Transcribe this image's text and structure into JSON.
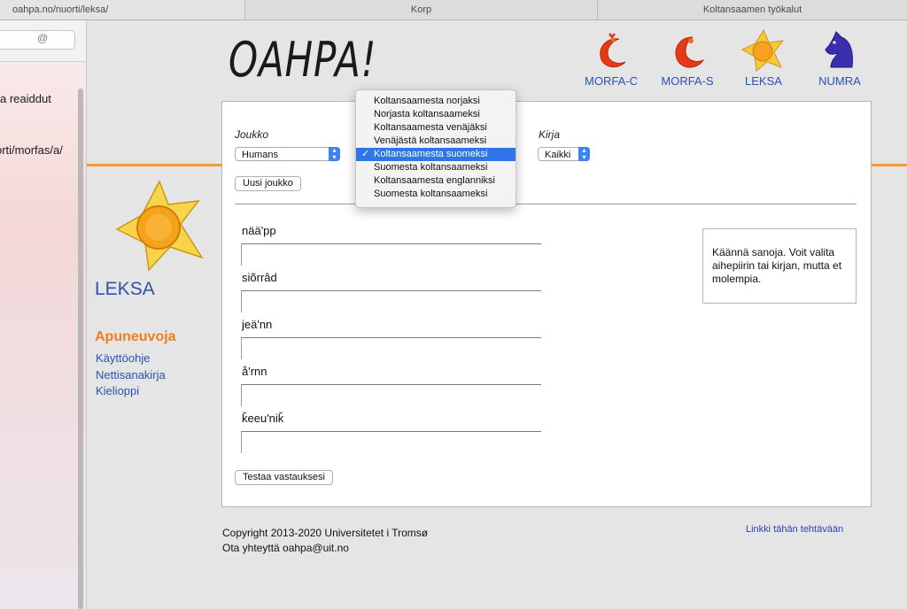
{
  "browser": {
    "tabs": [
      "oahpa.no/nuorti/leksa/",
      "Korp",
      "Koltansaamen työkalut"
    ]
  },
  "left_pane": {
    "search_symbol": "@",
    "lines": [
      "a reaiddut",
      "orti/morfas/a/"
    ]
  },
  "header": {
    "logo": "OAHPA!",
    "nav": [
      {
        "label": "MORFA-C",
        "icon": "red-crescent-c-icon"
      },
      {
        "label": "MORFA-S",
        "icon": "red-crescent-s-icon"
      },
      {
        "label": "LEKSA",
        "icon": "yellow-star-icon"
      },
      {
        "label": "NUMRA",
        "icon": "blue-knight-icon"
      }
    ]
  },
  "sidebar": {
    "title": "LEKSA",
    "tools_heading": "Apuneuvoja",
    "links": [
      "Käyttöohje",
      "Nettisanakirja",
      "Kielioppi"
    ]
  },
  "form": {
    "joukko_label": "Joukko",
    "joukko_value": "Humans",
    "kirja_label": "Kirja",
    "kirja_value": "Kaikki",
    "new_set_button": "Uusi joukko",
    "direction_options": [
      "Koltansaamesta norjaksi",
      "Norjasta koltansaameksi",
      "Koltansaamesta venäjäksi",
      "Venäjästä koltansaameksi",
      "Koltansaamesta suomeksi",
      "Suomesta koltansaameksi",
      "Koltansaamesta englanniksi",
      "Suomesta koltansaameksi"
    ],
    "selected_index": 4,
    "check_mark": "✓"
  },
  "exercise": {
    "words": [
      "nää'pp",
      "siõrrâd",
      "jeä'nn",
      "å'rnn",
      "ǩeeu'niǩ"
    ],
    "answers": [
      "",
      "",
      "",
      "",
      ""
    ],
    "submit_button": "Testaa vastauksesi",
    "instructions": "Käännä sanoja. Voit valita aihepiirin tai kirjan, mutta et molempia."
  },
  "footer": {
    "copyright": "Copyright 2013-2020 Universitetet i Tromsø",
    "contact": "Ota yhteyttä oahpa@uit.no",
    "permalink": "Linkki tähän tehtävään"
  },
  "colors": {
    "accent_orange": "#f39a32",
    "link_blue": "#2b52b0",
    "selection_blue": "#2f74e8"
  }
}
